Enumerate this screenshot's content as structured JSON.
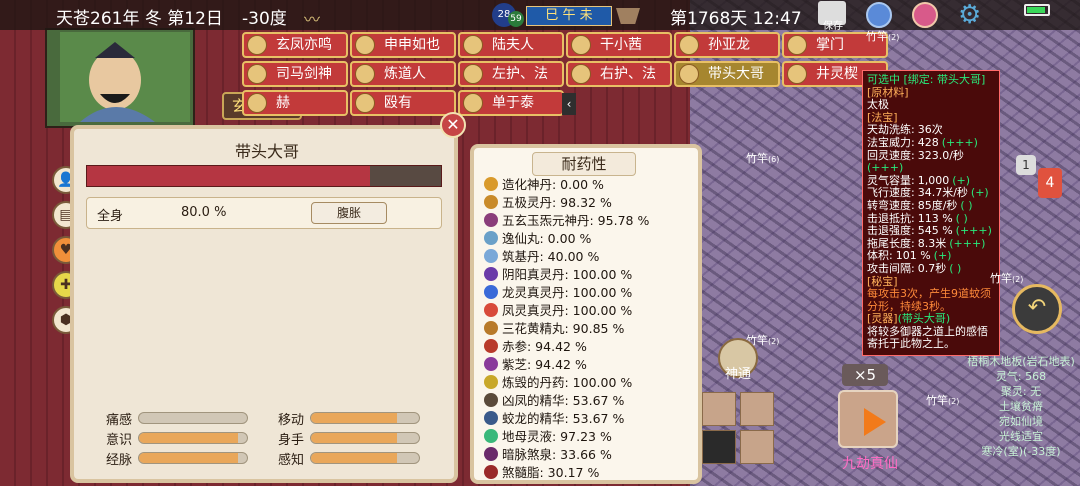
{
  "topbar": {
    "date": "天苍261年 冬 第12日",
    "temperature": "-30度",
    "time_of_day": "巳 午 未",
    "moon1": "28",
    "moon2": "59",
    "day_clock": "第1768天 12:47",
    "save_label": "保存"
  },
  "character": {
    "name": "玄黄真人"
  },
  "tabs": [
    {
      "label": "玄凤亦鸣",
      "selected": false
    },
    {
      "label": "申申如也",
      "selected": false
    },
    {
      "label": "陆夫人",
      "selected": false
    },
    {
      "label": "干小茜",
      "selected": false
    },
    {
      "label": "孙亚龙",
      "selected": false
    },
    {
      "label": "掌门",
      "selected": false
    },
    {
      "label": "司马剑神",
      "selected": false
    },
    {
      "label": "炼道人",
      "selected": false
    },
    {
      "label": "左护、法",
      "selected": false
    },
    {
      "label": "右护、法",
      "selected": false
    },
    {
      "label": "带头大哥",
      "selected": true
    },
    {
      "label": "井灵楔",
      "selected": false
    },
    {
      "label": "赫",
      "selected": false
    },
    {
      "label": "殴有",
      "selected": false
    },
    {
      "label": "单于泰",
      "selected": false
    }
  ],
  "health_panel": {
    "title": "带头大哥",
    "health_fraction": 0.8,
    "body_label": "全身",
    "body_value": "80.0 %",
    "condition_tag": "腹胀",
    "stats": [
      {
        "label": "痛感",
        "fill": 0.0
      },
      {
        "label": "移动",
        "fill": 0.8
      },
      {
        "label": "意识",
        "fill": 0.92
      },
      {
        "label": "身手",
        "fill": 0.8
      },
      {
        "label": "经脉",
        "fill": 0.92
      },
      {
        "label": "感知",
        "fill": 0.8
      }
    ]
  },
  "resistance_panel": {
    "title": "耐药性",
    "items": [
      {
        "text": "造化神丹: 0.00 %",
        "color": "#d99a2b"
      },
      {
        "text": "五极灵丹: 98.32 %",
        "color": "#c98b2a"
      },
      {
        "text": "五玄玉炁元神丹: 95.78 %",
        "color": "#8a3d7a"
      },
      {
        "text": "逸仙丸: 0.00 %",
        "color": "#6aa0c8"
      },
      {
        "text": "筑基丹: 40.00 %",
        "color": "#7aa8d8"
      },
      {
        "text": "阴阳真灵丹: 100.00 %",
        "color": "#6a3aa8"
      },
      {
        "text": "龙灵真灵丹: 100.00 %",
        "color": "#3a6ad8"
      },
      {
        "text": "凤灵真灵丹: 100.00 %",
        "color": "#d84a3a"
      },
      {
        "text": "三花黄精丸: 90.85 %",
        "color": "#b87a2a"
      },
      {
        "text": "赤参: 94.42 %",
        "color": "#b83a2a"
      },
      {
        "text": "紫芝: 94.42 %",
        "color": "#8a3a9a"
      },
      {
        "text": "炼毁的丹药: 100.00 %",
        "color": "#c8a82a"
      },
      {
        "text": "凶凤的精华: 53.67 %",
        "color": "#5a4a3a"
      },
      {
        "text": "蛟龙的精华: 53.67 %",
        "color": "#3a5a8a"
      },
      {
        "text": "地母灵液: 97.23 %",
        "color": "#3ab87a"
      },
      {
        "text": "暗脉煞泉: 33.66 %",
        "color": "#6a2a6a"
      },
      {
        "text": "煞髓脂: 30.17 %",
        "color": "#9a2a2a"
      }
    ]
  },
  "artifact": {
    "header": "可选中 [绑定: 带头大哥]",
    "material_section": "[原材料]",
    "material": "太极",
    "fabao_section": "[法宝]",
    "lines": [
      {
        "k": "天劫洗练:",
        "v": "36次",
        "tag": ""
      },
      {
        "k": "法宝威力:",
        "v": "428",
        "tag": "(+++)"
      },
      {
        "k": "回灵速度:",
        "v": "323.0/秒",
        "tag": "(+++)"
      },
      {
        "k": "灵气容量:",
        "v": "1,000",
        "tag": "(+)"
      },
      {
        "k": "飞行速度:",
        "v": "34.7米/秒",
        "tag": "(+)"
      },
      {
        "k": "转弯速度:",
        "v": "85度/秒",
        "tag": "( )"
      },
      {
        "k": "击退抵抗:",
        "v": "113 %",
        "tag": "( )"
      },
      {
        "k": "击退强度:",
        "v": "545 %",
        "tag": "(+++)"
      },
      {
        "k": "拖尾长度:",
        "v": "8.3米",
        "tag": "(+++)"
      },
      {
        "k": "体积:",
        "v": "101 %",
        "tag": "(+)"
      },
      {
        "k": "攻击间隔:",
        "v": "0.7秒",
        "tag": "( )"
      }
    ],
    "secret_section": "[秘宝]",
    "secret_text": "每攻击3次，产生9道蚊须分形，持续3秒。",
    "spirit_section": "[灵器]",
    "spirit_owner": "(带头大哥)",
    "spirit_text": "将较多御器之道上的感悟寄托于此物之上。"
  },
  "map_labels": {
    "bamboo": "竹竿",
    "bamboo_counts": [
      "(6)",
      "(2)",
      "(2)",
      "(2)",
      "(2)"
    ],
    "tile_info": [
      "梧桐木地板(岩石地表)",
      "灵气: 568",
      "聚灵: 无",
      "土壤贫瘠",
      "宛如仙境",
      "光线适宜",
      "寒冷(室)(-33度)"
    ]
  },
  "controls": {
    "speed": "×5",
    "nine_disaster": "九劫真仙",
    "shentong": "神通",
    "badge_red": "4",
    "badge_gray": "1"
  }
}
